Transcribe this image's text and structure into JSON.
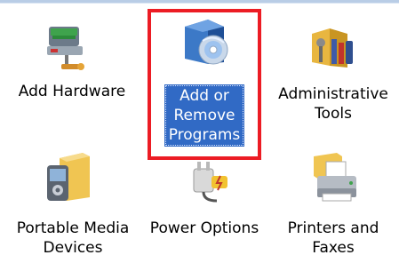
{
  "panel": {
    "items": [
      {
        "label": "Add Hardware",
        "icon": "add-hardware-icon"
      },
      {
        "label_lines": [
          "Add or",
          "Remove",
          "Programs"
        ],
        "icon": "add-remove-programs-icon",
        "selected": true
      },
      {
        "label_lines": [
          "Administrative",
          "Tools"
        ],
        "icon": "administrative-tools-icon"
      },
      {
        "label_lines": [
          "Portable Media",
          "Devices"
        ],
        "icon": "portable-media-devices-icon"
      },
      {
        "label": "Power Options",
        "icon": "power-options-icon"
      },
      {
        "label_lines": [
          "Printers and",
          "Faxes"
        ],
        "icon": "printers-and-faxes-icon"
      }
    ]
  },
  "colors": {
    "selection": "#316ac5",
    "callout_border": "#ec1c24"
  }
}
